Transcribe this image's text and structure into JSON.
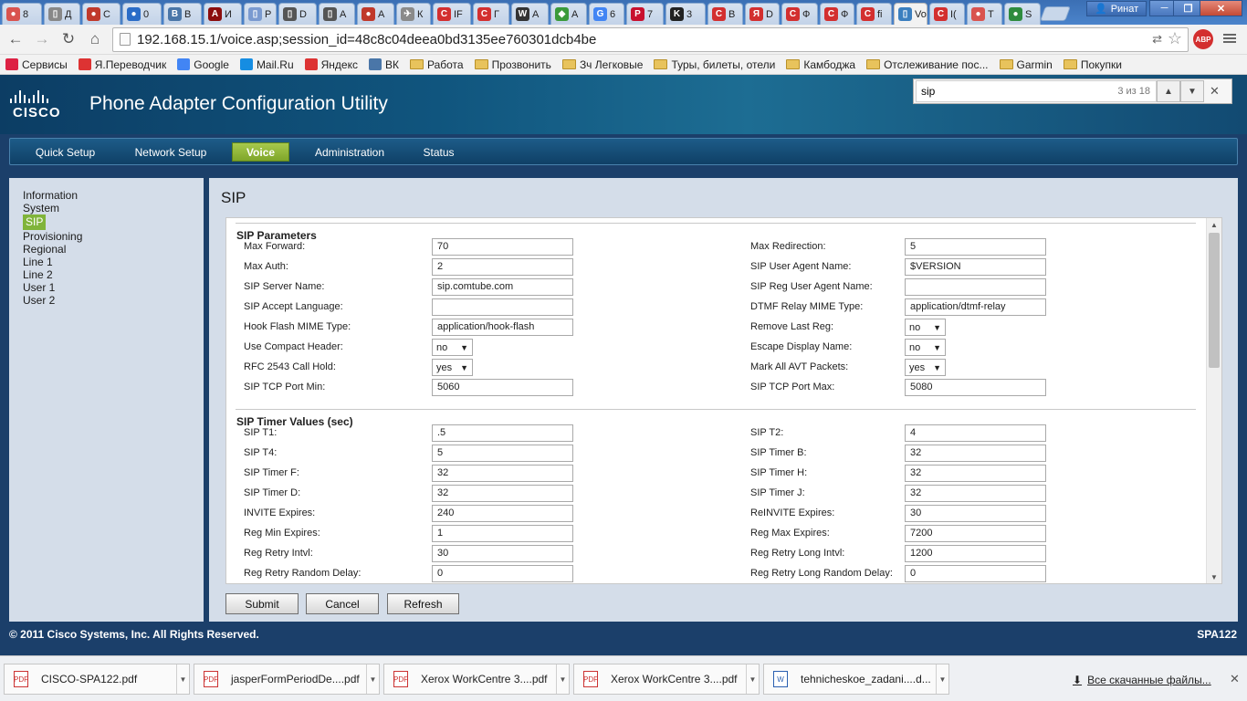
{
  "browser": {
    "tabs": [
      {
        "label": "8",
        "color": "#d9534f",
        "glyph": "●"
      },
      {
        "label": "Д",
        "color": "#888888",
        "glyph": "▯"
      },
      {
        "label": "С",
        "color": "#c0392b",
        "glyph": "●"
      },
      {
        "label": "0",
        "color": "#2a6cc7",
        "glyph": "●"
      },
      {
        "label": "В",
        "color": "#4a76a8",
        "glyph": "B"
      },
      {
        "label": "И",
        "color": "#8b0d0d",
        "glyph": "A"
      },
      {
        "label": "Р",
        "color": "#7a9ad0",
        "glyph": "▯"
      },
      {
        "label": "D",
        "color": "#555555",
        "glyph": "▯"
      },
      {
        "label": "А",
        "color": "#555555",
        "glyph": "▯"
      },
      {
        "label": "А",
        "color": "#c0392b",
        "glyph": "●"
      },
      {
        "label": "К",
        "color": "#8a8a8a",
        "glyph": "✈"
      },
      {
        "label": "IF",
        "color": "#d32f2f",
        "glyph": "C"
      },
      {
        "label": "Г",
        "color": "#d32f2f",
        "glyph": "C"
      },
      {
        "label": "А",
        "color": "#333333",
        "glyph": "W"
      },
      {
        "label": "А",
        "color": "#3a9a3a",
        "glyph": "◆"
      },
      {
        "label": "6",
        "color": "#4285f4",
        "glyph": "G"
      },
      {
        "label": "7",
        "color": "#c8102e",
        "glyph": "P"
      },
      {
        "label": "3",
        "color": "#222222",
        "glyph": "K"
      },
      {
        "label": "В",
        "color": "#d32f2f",
        "glyph": "C"
      },
      {
        "label": "D",
        "color": "#d32f2f",
        "glyph": "Я"
      },
      {
        "label": "Ф",
        "color": "#d32f2f",
        "glyph": "C"
      },
      {
        "label": "Ф",
        "color": "#d32f2f",
        "glyph": "C"
      },
      {
        "label": "fi",
        "color": "#d32f2f",
        "glyph": "C"
      },
      {
        "label": "Vo",
        "color": "#3b7fbf",
        "glyph": "▯"
      },
      {
        "label": "I(",
        "color": "#d32f2f",
        "glyph": "C"
      },
      {
        "label": "Т",
        "color": "#d9534f",
        "glyph": "●"
      },
      {
        "label": "S",
        "color": "#2e8b3e",
        "glyph": "●"
      }
    ],
    "user": "Ринат",
    "url": "192.168.15.1/voice.asp;session_id=48c8c04deea0bd3135ee760301dcb4be",
    "abp_label": "ABP",
    "bookmarks": [
      {
        "label": "Сервисы",
        "icon": "apps-icon",
        "color": "#d24"
      },
      {
        "label": "Я.Переводчик",
        "icon": "translate-icon",
        "color": "#d33"
      },
      {
        "label": "Google",
        "icon": "google-icon",
        "color": "#4285f4"
      },
      {
        "label": "Mail.Ru",
        "icon": "mailru-icon",
        "color": "#168de2"
      },
      {
        "label": "Яндекс",
        "icon": "yandex-icon",
        "color": "#d33"
      },
      {
        "label": "ВК",
        "icon": "vk-icon",
        "color": "#4a76a8"
      },
      {
        "label": "Работа",
        "icon": "folder-icon"
      },
      {
        "label": "Прозвонить",
        "icon": "folder-icon"
      },
      {
        "label": "Зч Легковые",
        "icon": "folder-icon"
      },
      {
        "label": "Туры, билеты, отели",
        "icon": "folder-icon"
      },
      {
        "label": "Камбоджа",
        "icon": "folder-icon"
      },
      {
        "label": "Отслеживание пос...",
        "icon": "folder-icon"
      },
      {
        "label": "Garmin",
        "icon": "folder-icon"
      },
      {
        "label": "Покупки",
        "icon": "folder-icon"
      }
    ]
  },
  "find": {
    "query": "sip",
    "count": "3 из 18"
  },
  "header": {
    "brand": "CISCO",
    "title": "Phone Adapter Configuration Utility"
  },
  "nav": [
    "Quick Setup",
    "Network Setup",
    "Voice",
    "Administration",
    "Status"
  ],
  "sidebar": [
    "Information",
    "System",
    "SIP",
    "Provisioning",
    "Regional",
    "Line 1",
    "Line 2",
    "User 1",
    "User 2"
  ],
  "page_title": "SIP",
  "sections": {
    "params_title": "SIP Parameters",
    "timer_title": "SIP Timer Values (sec)"
  },
  "params": [
    {
      "l1": "Max Forward:",
      "v1": "70",
      "l2": "Max Redirection:",
      "v2": "5"
    },
    {
      "l1": "Max Auth:",
      "v1": "2",
      "l2": "SIP User Agent Name:",
      "v2": "$VERSION"
    },
    {
      "l1": "SIP Server Name:",
      "v1": "sip.comtube.com",
      "l2": "SIP Reg User Agent Name:",
      "v2": ""
    },
    {
      "l1": "SIP Accept Language:",
      "v1": "",
      "l2": "DTMF Relay MIME Type:",
      "v2": "application/dtmf-relay"
    },
    {
      "l1": "Hook Flash MIME Type:",
      "v1": "application/hook-flash",
      "l2": "Remove Last Reg:",
      "v2": "no"
    },
    {
      "l1": "Use Compact Header:",
      "v1": "no",
      "l2": "Escape Display Name:",
      "v2": "no"
    },
    {
      "l1": "RFC 2543 Call Hold:",
      "v1": "yes",
      "l2": "Mark All AVT Packets:",
      "v2": "yes"
    },
    {
      "l1": "SIP TCP Port Min:",
      "v1": "5060",
      "l2": "SIP TCP Port Max:",
      "v2": "5080"
    }
  ],
  "timers": [
    {
      "l1": "SIP T1:",
      "v1": ".5",
      "l2": "SIP T2:",
      "v2": "4"
    },
    {
      "l1": "SIP T4:",
      "v1": "5",
      "l2": "SIP Timer B:",
      "v2": "32"
    },
    {
      "l1": "SIP Timer F:",
      "v1": "32",
      "l2": "SIP Timer H:",
      "v2": "32"
    },
    {
      "l1": "SIP Timer D:",
      "v1": "32",
      "l2": "SIP Timer J:",
      "v2": "32"
    },
    {
      "l1": "INVITE Expires:",
      "v1": "240",
      "l2": "ReINVITE Expires:",
      "v2": "30"
    },
    {
      "l1": "Reg Min Expires:",
      "v1": "1",
      "l2": "Reg Max Expires:",
      "v2": "7200"
    },
    {
      "l1": "Reg Retry Intvl:",
      "v1": "30",
      "l2": "Reg Retry Long Intvl:",
      "v2": "1200"
    },
    {
      "l1": "Reg Retry Random Delay:",
      "v1": "0",
      "l2": "Reg Retry Long Random Delay:",
      "v2": "0"
    }
  ],
  "buttons": {
    "submit": "Submit",
    "cancel": "Cancel",
    "refresh": "Refresh"
  },
  "footer": {
    "copyright": "© 2011 Cisco Systems, Inc. All Rights Reserved.",
    "model": "SPA122"
  },
  "downloads": {
    "items": [
      {
        "name": "CISCO-SPA122.pdf",
        "type": "pdf"
      },
      {
        "name": "jasperFormPeriodDe....pdf",
        "type": "pdf"
      },
      {
        "name": "Xerox WorkCentre 3....pdf",
        "type": "pdf"
      },
      {
        "name": "Xerox WorkCentre 3....pdf",
        "type": "pdf"
      },
      {
        "name": "tehnicheskoe_zadani....d...",
        "type": "doc"
      }
    ],
    "show_all": "Все скачанные файлы..."
  }
}
